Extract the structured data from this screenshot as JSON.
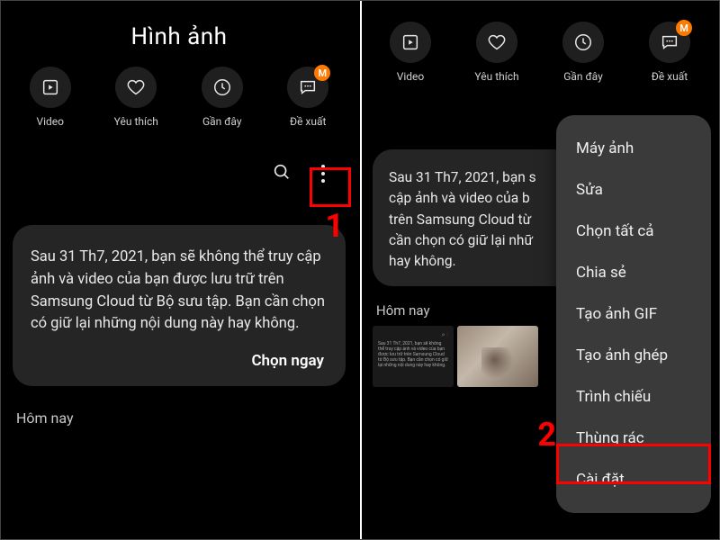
{
  "title": "Hình ảnh",
  "tabs": [
    {
      "id": "video",
      "label": "Video"
    },
    {
      "id": "favorites",
      "label": "Yêu thích"
    },
    {
      "id": "recent",
      "label": "Gần đây"
    },
    {
      "id": "suggest",
      "label": "Đề xuất",
      "badge": "M"
    }
  ],
  "notice": {
    "text_full": "Sau 31 Th7, 2021, bạn sẽ không thể truy cập ảnh và video của bạn được lưu trữ trên Samsung Cloud từ Bộ sưu tập. Bạn cần chọn có giữ lại những nội dung này hay không.",
    "text_cut": "Sau 31 Th7, 2021, bạn s\ncập ảnh và video của b\ntrên Samsung Cloud từ\ncần chọn có giữ lại nhữ\nhay không.",
    "action": "Chọn ngay"
  },
  "section_today": "Hôm nay",
  "menu": {
    "items": [
      "Máy ảnh",
      "Sửa",
      "Chọn tất cả",
      "Chia sẻ",
      "Tạo ảnh GIF",
      "Tạo ảnh ghép",
      "Trình chiếu",
      "Thùng rác",
      "Cài đặt"
    ]
  },
  "steps": {
    "one": "1",
    "two": "2"
  }
}
